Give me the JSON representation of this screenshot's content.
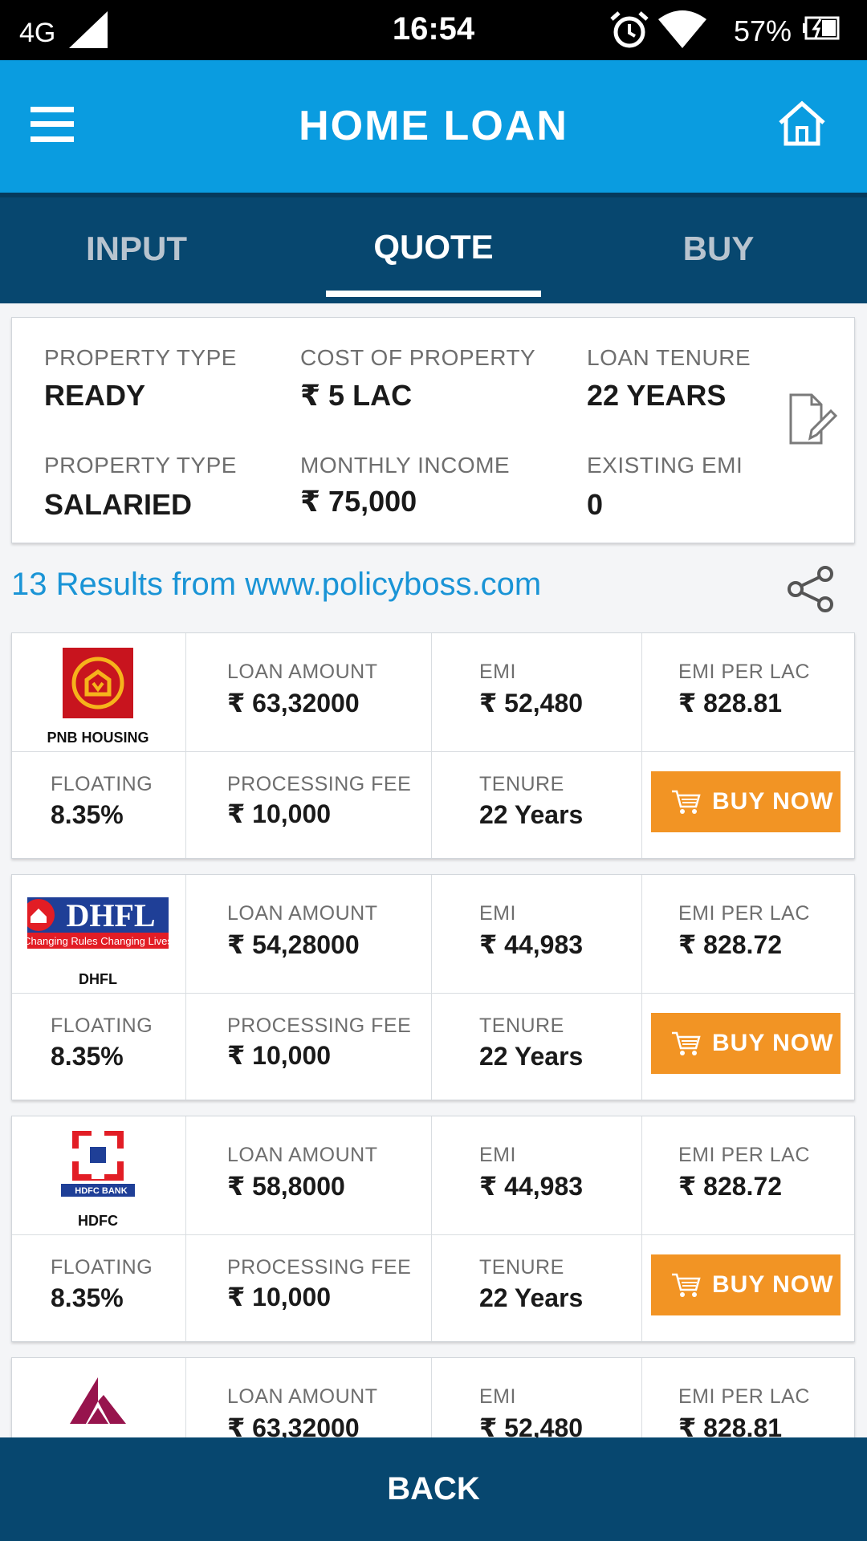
{
  "status_bar": {
    "network": "4G",
    "time": "16:54",
    "battery": "57%"
  },
  "app_bar": {
    "title": "HOME LOAN",
    "menu_icon": "hamburger-menu-icon",
    "home_icon": "home-icon"
  },
  "tabs": [
    {
      "label": "INPUT"
    },
    {
      "label": "QUOTE",
      "active": true
    },
    {
      "label": "BUY"
    }
  ],
  "summary": {
    "property_type_label": "PROPERTY TYPE",
    "property_type_value": "READY",
    "cost_label": "COST OF PROPERTY",
    "cost_value": "₹ 5 LAC",
    "tenure_label": "LOAN TENURE",
    "tenure_value": "22 YEARS",
    "employment_label": "PROPERTY TYPE",
    "employment_value": "SALARIED",
    "income_label": "MONTHLY INCOME",
    "income_value": "₹ 75,000",
    "emi_label": "EXISTING EMI",
    "emi_value": "0"
  },
  "results_text": "13 Results from www.policyboss.com",
  "labels": {
    "loan_amount": "LOAN AMOUNT",
    "emi": "EMI",
    "emi_per_lac": "EMI PER LAC",
    "floating": "FLOATING",
    "processing_fee": "PROCESSING FEE",
    "tenure": "TENURE",
    "buy_now": "BUY NOW"
  },
  "quotes": [
    {
      "bank": "PNB HOUSING",
      "loan_amount": "₹ 63,32000",
      "emi": "₹ 52,480",
      "emi_per_lac": "₹ 828.81",
      "rate": "8.35%",
      "processing_fee": "₹ 10,000",
      "tenure": "22 Years",
      "brand_color": "#c8141e"
    },
    {
      "bank": "DHFL",
      "logo_text": "DHFL",
      "tagline": "Changing Rules Changing Lives",
      "loan_amount": "₹ 54,28000",
      "emi": "₹ 44,983",
      "emi_per_lac": "₹ 828.72",
      "rate": "8.35%",
      "processing_fee": "₹ 10,000",
      "tenure": "22 Years",
      "brand_color": "#1f3f97"
    },
    {
      "bank": "HDFC",
      "logo_text": "HDFC BANK",
      "loan_amount": "₹ 58,8000",
      "emi": "₹ 44,983",
      "emi_per_lac": "₹ 828.72",
      "rate": "8.35%",
      "processing_fee": "₹ 10,000",
      "tenure": "22 Years",
      "brand_color": "#e21d25"
    },
    {
      "bank": "",
      "loan_amount": "₹ 63,32000",
      "emi": "₹ 52,480",
      "emi_per_lac": "₹ 828.81",
      "brand_color": "#97144d"
    }
  ],
  "back_label": "BACK"
}
